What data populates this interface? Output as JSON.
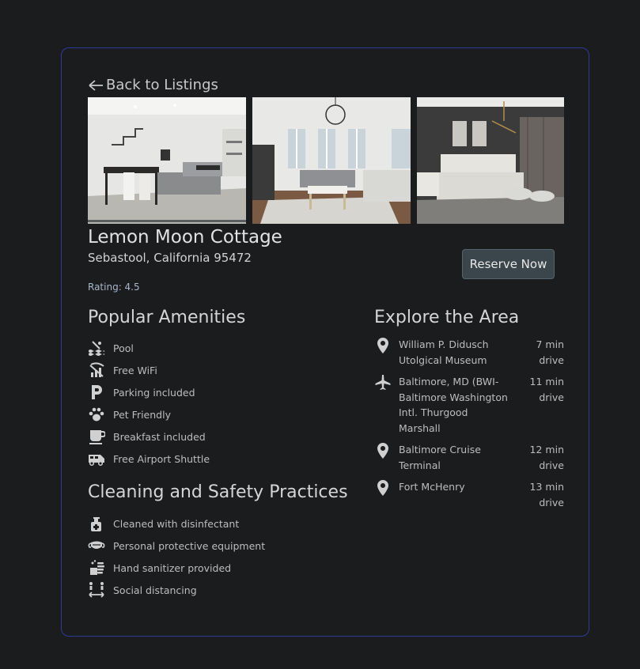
{
  "nav": {
    "back_label": "Back to Listings"
  },
  "gallery": {
    "photos": [
      {
        "icon": "living-room-photo"
      },
      {
        "icon": "lounge-photo"
      },
      {
        "icon": "bedroom-photo"
      }
    ]
  },
  "listing": {
    "title": "Lemon Moon Cottage",
    "address": "Sebastool, California 95472",
    "rating": "Rating: 4.5",
    "reserve_label": "Reserve Now"
  },
  "amenities": {
    "heading": "Popular Amenities",
    "items": [
      {
        "label": "Pool",
        "icon": "pool-icon"
      },
      {
        "label": "Free WiFi",
        "icon": "wifi-icon"
      },
      {
        "label": "Parking included",
        "icon": "parking-icon"
      },
      {
        "label": "Pet Friendly",
        "icon": "paw-icon"
      },
      {
        "label": "Breakfast included",
        "icon": "coffee-icon"
      },
      {
        "label": "Free Airport Shuttle",
        "icon": "shuttle-icon"
      }
    ]
  },
  "cleaning": {
    "heading": "Cleaning and Safety Practices",
    "items": [
      {
        "label": "Cleaned with disinfectant",
        "icon": "spray-bottle-icon"
      },
      {
        "label": "Personal protective equipment",
        "icon": "mask-icon"
      },
      {
        "label": "Hand sanitizer provided",
        "icon": "hand-wash-icon"
      },
      {
        "label": "Social distancing",
        "icon": "distancing-icon"
      }
    ]
  },
  "explore": {
    "heading": "Explore the Area",
    "items": [
      {
        "name": "William P. Didusch Utolgical Museum",
        "time": "7 min drive",
        "icon": "map-pin-icon"
      },
      {
        "name": "Baltimore, MD (BWI-Baltimore Washington Intl. Thurgood Marshall",
        "time": "11 min drive",
        "icon": "airplane-icon"
      },
      {
        "name": "Baltimore Cruise Terminal",
        "time": "12 min drive",
        "icon": "map-pin-icon"
      },
      {
        "name": "Fort McHenry",
        "time": "13 min drive",
        "icon": "map-pin-icon"
      }
    ]
  },
  "colors": {
    "card_border": "#2f3a9a",
    "button_bg": "#3b454c",
    "page_bg": "#1b1c1e"
  }
}
